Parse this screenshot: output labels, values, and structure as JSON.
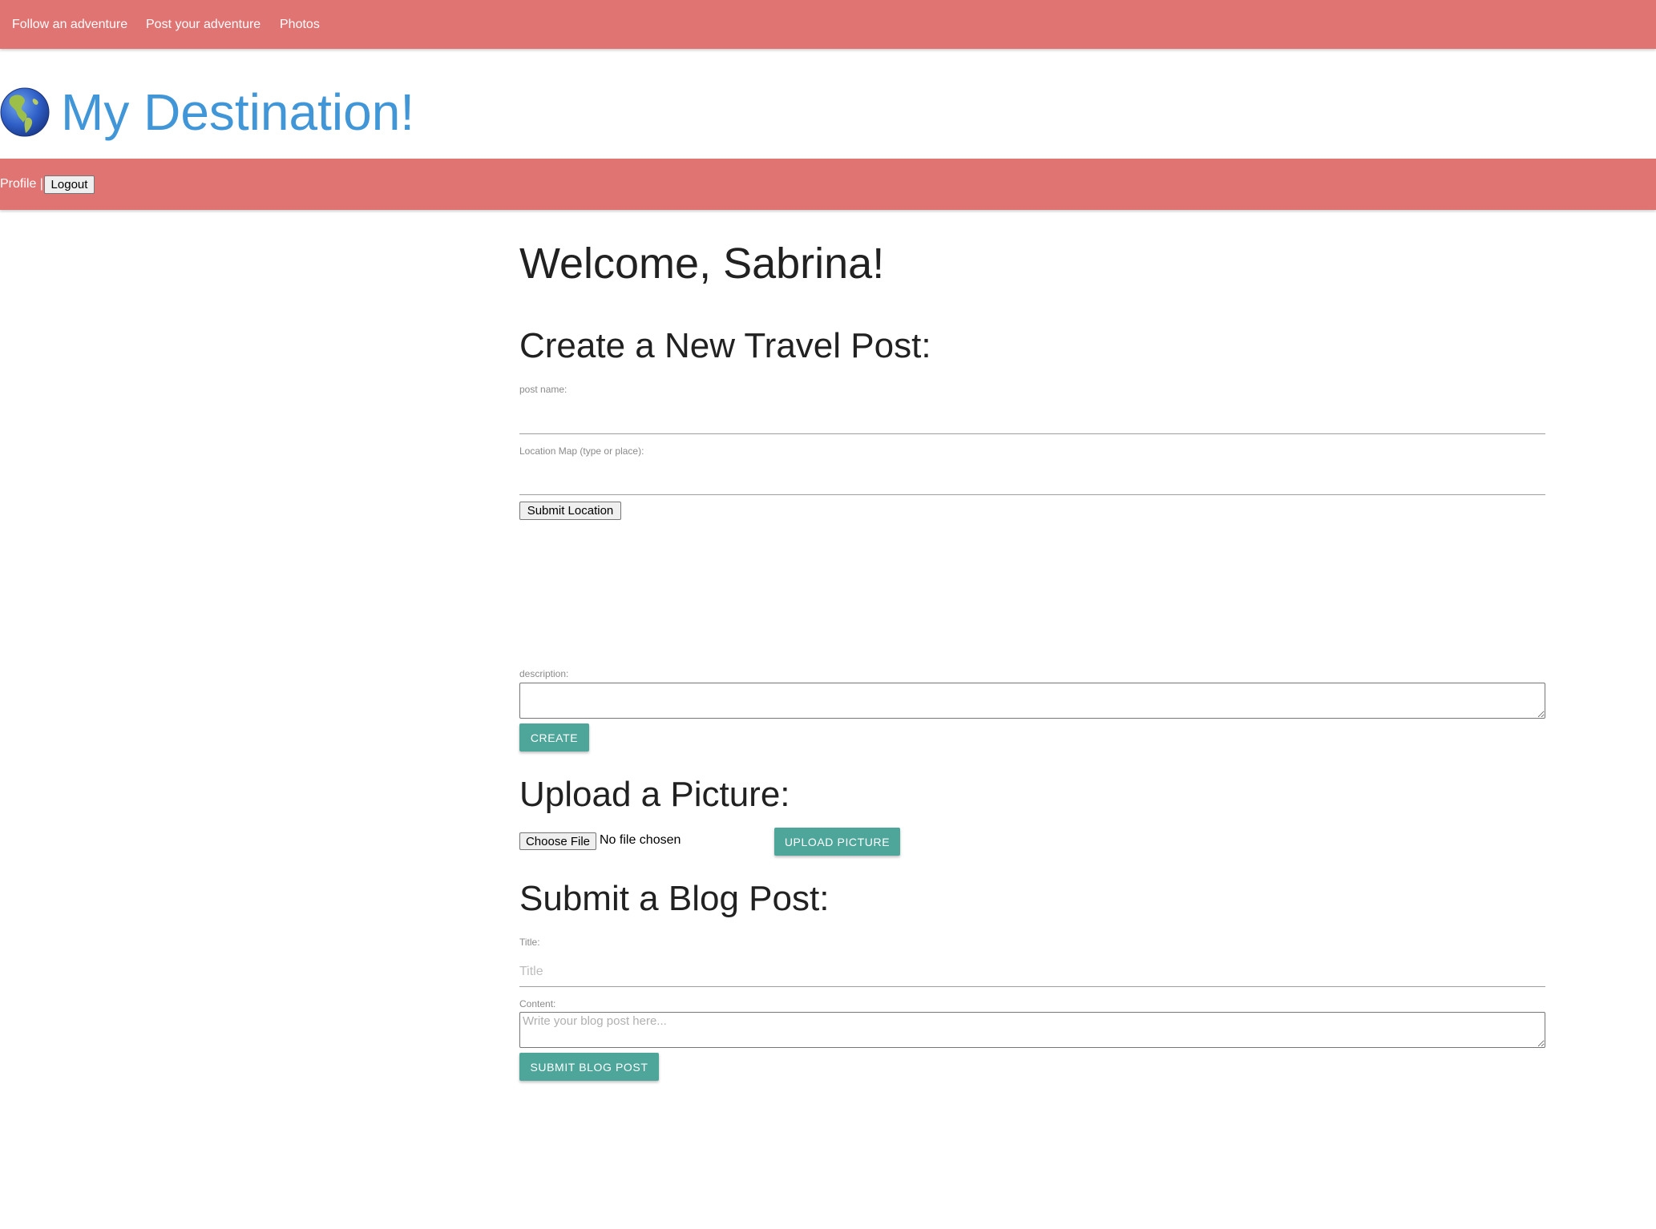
{
  "top_nav": {
    "items": [
      "Follow an adventure",
      "Post your adventure",
      "Photos"
    ],
    "background": "#e07473"
  },
  "brand": {
    "icon": "globe-americas-icon",
    "title": "My Destination!",
    "color": "#4196d8"
  },
  "sub_nav": {
    "profile_label": "Profile |",
    "logout_label": "Logout"
  },
  "main": {
    "welcome": "Welcome, Sabrina!",
    "travel_post": {
      "heading": "Create a New Travel Post:",
      "post_name_label": "post name:",
      "post_name_value": "",
      "location_label": "Location Map (type or place):",
      "location_value": "",
      "submit_location_label": "Submit Location",
      "description_label": "description:",
      "description_value": "",
      "create_label": "CREATE"
    },
    "upload": {
      "heading": "Upload a Picture:",
      "choose_file_label": "Choose File",
      "file_status": "No file chosen",
      "upload_label": "UPLOAD PICTURE"
    },
    "blog": {
      "heading": "Submit a Blog Post:",
      "title_label": "Title:",
      "title_placeholder": "Title",
      "content_label": "Content:",
      "content_placeholder": "Write your blog post here...",
      "submit_label": "SUBMIT BLOG POST"
    }
  },
  "colors": {
    "accent_button": "#4ea69b",
    "nav_bar": "#e07473",
    "brand_text": "#4196d8"
  }
}
